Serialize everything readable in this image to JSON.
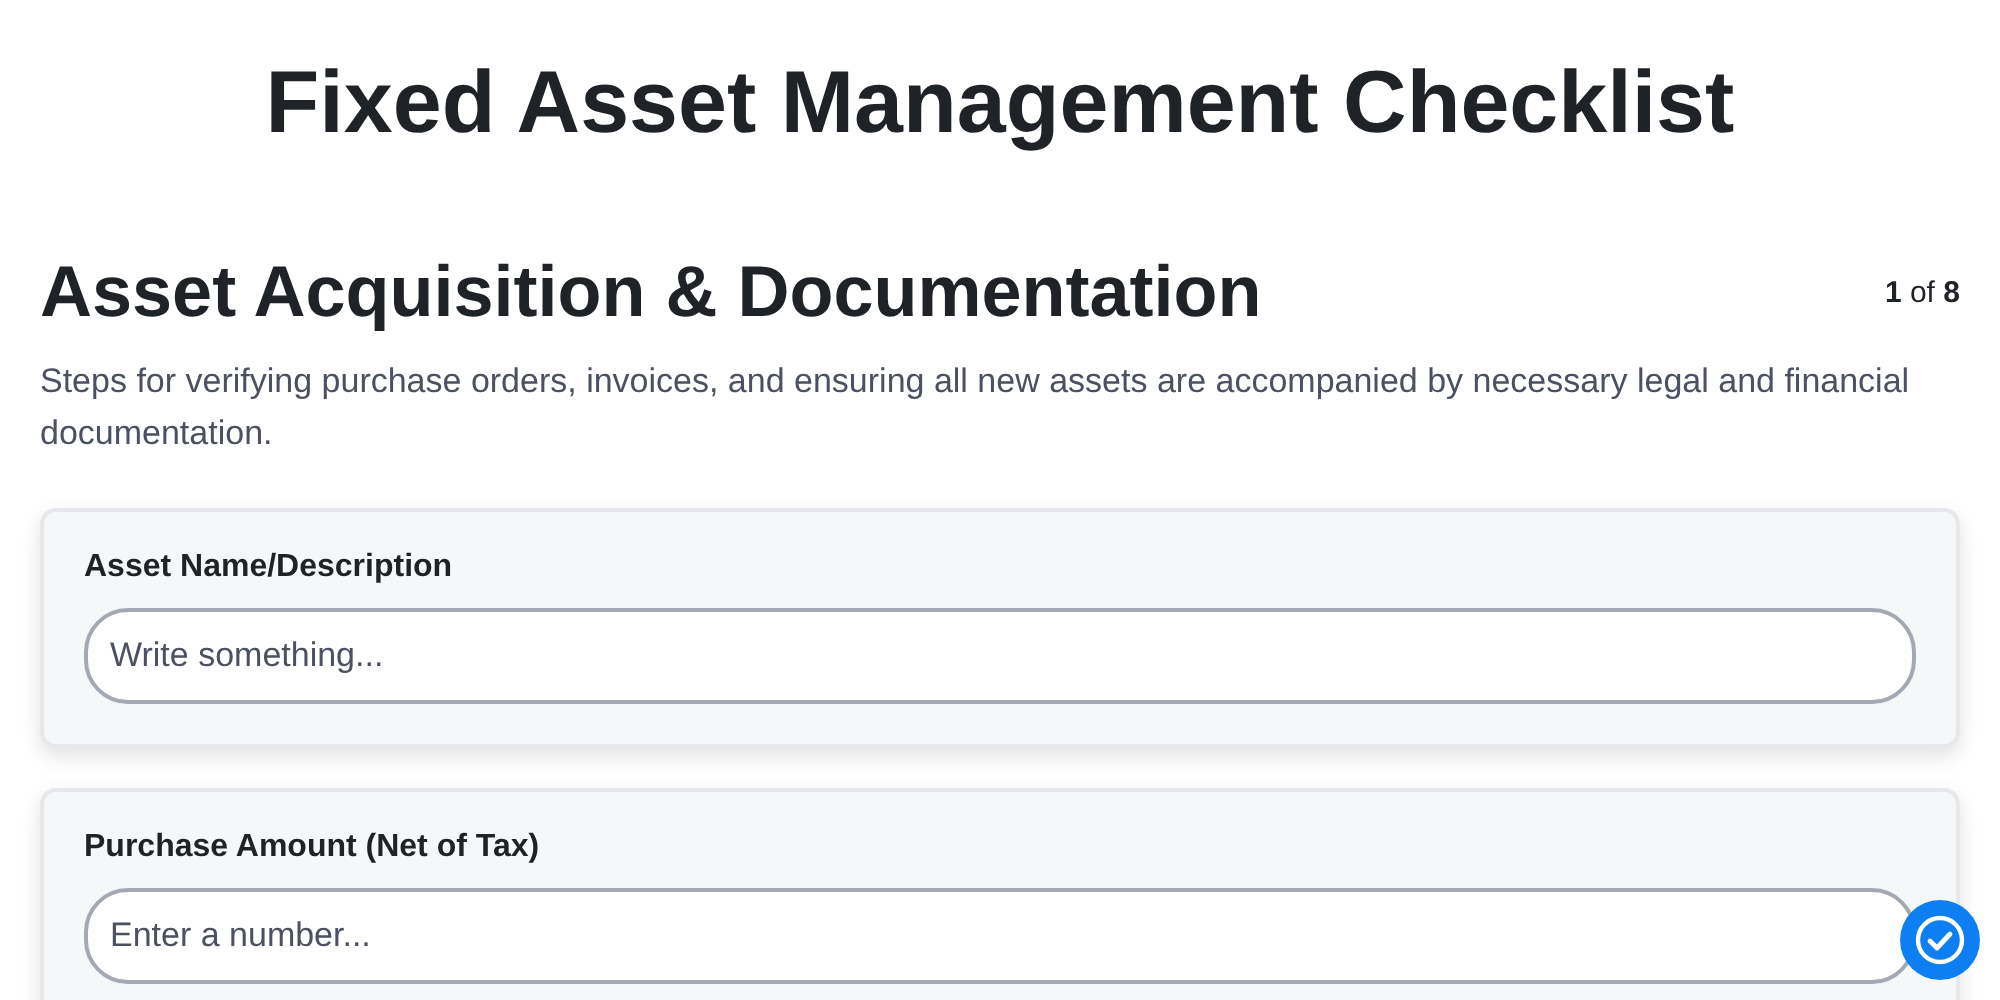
{
  "title": "Fixed Asset Management Checklist",
  "section": {
    "heading": "Asset Acquisition & Documentation",
    "progress": "**1** of **8**",
    "description": "Steps for verifying purchase orders, invoices, and ensuring all new assets are accompanied by necessary legal and financial documentation."
  },
  "fields": [
    {
      "label": "Asset Name/Description",
      "placeholder": "Write something..."
    },
    {
      "label": "Purchase Amount (Net of Tax)",
      "placeholder": "Enter a number..."
    }
  ]
}
